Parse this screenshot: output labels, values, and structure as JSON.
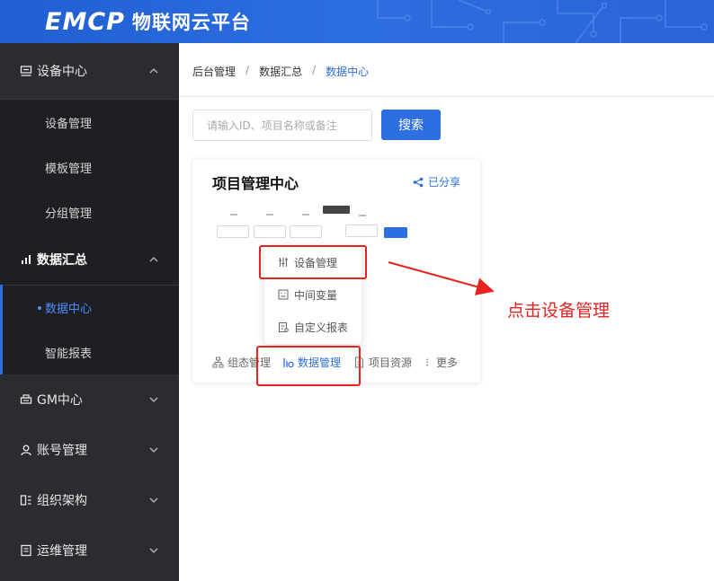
{
  "header": {
    "logo_mark": "EMCP",
    "logo_text": "物联网云平台"
  },
  "sidebar": {
    "groups": [
      {
        "label": "设备中心",
        "icon": "device-icon",
        "open": true,
        "items": [
          "设备管理",
          "模板管理",
          "分组管理"
        ]
      },
      {
        "label": "数据汇总",
        "icon": "chart-icon",
        "open": true,
        "items": [
          "数据中心",
          "智能报表"
        ],
        "active_item": "数据中心"
      },
      {
        "label": "GM中心",
        "icon": "printer-icon",
        "open": false
      },
      {
        "label": "账号管理",
        "icon": "user-icon",
        "open": false
      },
      {
        "label": "组织架构",
        "icon": "org-icon",
        "open": false
      },
      {
        "label": "运维管理",
        "icon": "clipboard-icon",
        "open": false
      }
    ]
  },
  "breadcrumb": [
    "后台管理",
    "数据汇总",
    "数据中心"
  ],
  "breadcrumb_sep": "/",
  "search": {
    "placeholder": "请输入ID、项目名称或备注",
    "button_label": "搜索"
  },
  "card": {
    "title": "项目管理中心",
    "share_label": "已分享",
    "footer": {
      "config": "组态管理",
      "data": "数据管理",
      "resource": "项目资源",
      "more": "更多"
    }
  },
  "dropdown_menu": {
    "items": [
      "设备管理",
      "中间变量",
      "自定义报表"
    ]
  },
  "annotation": {
    "text": "点击设备管理"
  },
  "colors": {
    "primary": "#2d6ee0",
    "sidebar_bg": "#2b2c30",
    "sidebar_sub_bg": "#1e1f22",
    "highlight_red": "#e8231f"
  }
}
